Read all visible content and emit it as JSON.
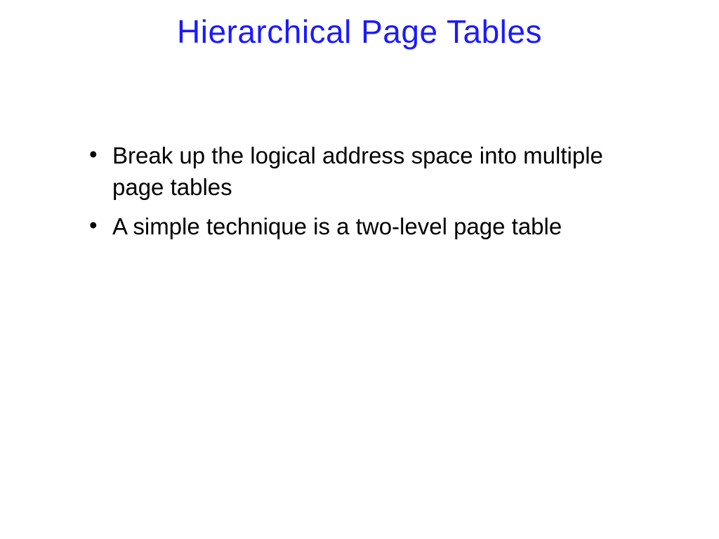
{
  "slide": {
    "title": "Hierarchical Page Tables",
    "bullets": [
      "Break up the logical address space into multiple page tables",
      "A simple technique is a two-level page table"
    ]
  }
}
